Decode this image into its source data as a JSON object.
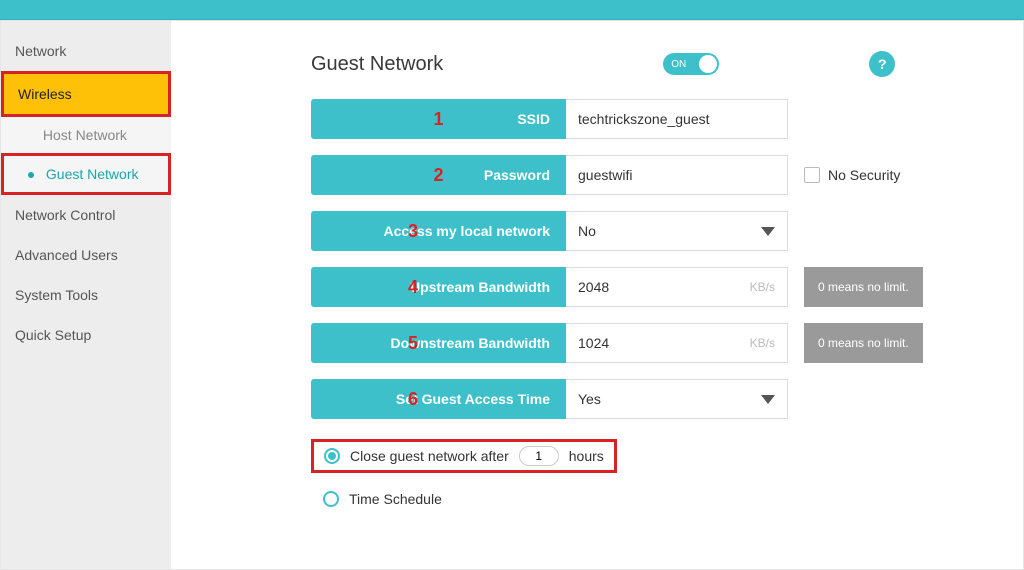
{
  "sidebar": {
    "items": [
      {
        "label": "Network"
      },
      {
        "label": "Wireless"
      },
      {
        "sub": [
          {
            "label": "Host Network"
          },
          {
            "label": "Guest Network"
          }
        ]
      },
      {
        "label": "Network Control"
      },
      {
        "label": "Advanced Users"
      },
      {
        "label": "System Tools"
      },
      {
        "label": "Quick Setup"
      }
    ]
  },
  "page": {
    "title": "Guest Network",
    "toggle_label": "ON",
    "help_glyph": "?"
  },
  "annotations": {
    "r1": "1",
    "r2": "2",
    "r3": "3",
    "r4": "4",
    "r5": "5",
    "r6": "6"
  },
  "form": {
    "ssid": {
      "label": "SSID",
      "value": "techtrickszone_guest"
    },
    "password": {
      "label": "Password",
      "value": "guestwifi",
      "no_security_label": "No Security"
    },
    "access_local": {
      "label": "Access my local network",
      "value": "No"
    },
    "upstream": {
      "label": "Upstream Bandwidth",
      "value": "2048",
      "unit": "KB/s",
      "hint": "0 means no limit."
    },
    "downstream": {
      "label": "Downstream Bandwidth",
      "value": "1024",
      "unit": "KB/s",
      "hint": "0 means no limit."
    },
    "access_time": {
      "label": "Set Guest Access Time",
      "value": "Yes"
    }
  },
  "timing": {
    "close_after_prefix": "Close guest network after",
    "close_after_hours": "1",
    "close_after_suffix": "hours",
    "schedule_label": "Time Schedule"
  }
}
